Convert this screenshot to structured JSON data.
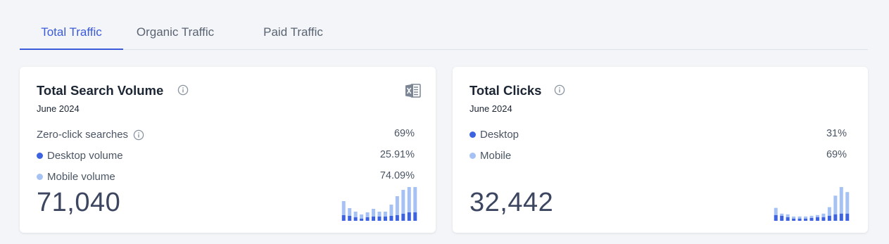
{
  "tabs": [
    {
      "label": "Total Traffic",
      "active": true
    },
    {
      "label": "Organic Traffic",
      "active": false
    },
    {
      "label": "Paid Traffic",
      "active": false
    }
  ],
  "colors": {
    "accent": "#3b5bdb",
    "desktop": "#3d63e0",
    "mobile": "#a6c2f5"
  },
  "search_volume": {
    "title": "Total Search Volume",
    "period": "June 2024",
    "icon": "excel-export-icon",
    "rows": [
      {
        "label": "Zero-click searches",
        "value": "69%",
        "dot": null,
        "info": true
      },
      {
        "label": "Desktop volume",
        "value": "25.91%",
        "dot": "desktop",
        "info": false
      },
      {
        "label": "Mobile volume",
        "value": "74.09%",
        "dot": "mobile",
        "info": false
      }
    ],
    "total": "71,040"
  },
  "clicks": {
    "title": "Total Clicks",
    "period": "June 2024",
    "rows": [
      {
        "label": "Desktop",
        "value": "31%",
        "dot": "desktop"
      },
      {
        "label": "Mobile",
        "value": "69%",
        "dot": "mobile"
      }
    ],
    "total": "32,442"
  },
  "sparklines": {
    "search_volume": {
      "series": [
        {
          "name": "desktop",
          "values": [
            8,
            7,
            5,
            3,
            5,
            6,
            6,
            6,
            7,
            8,
            10,
            12,
            12
          ]
        },
        {
          "name": "mobile",
          "values": [
            20,
            11,
            8,
            6,
            7,
            11,
            7,
            7,
            16,
            27,
            34,
            36,
            36
          ]
        }
      ]
    },
    "clicks": {
      "series": [
        {
          "name": "desktop",
          "values": [
            8,
            7,
            5,
            3,
            3,
            3,
            4,
            5,
            5,
            7,
            9,
            10,
            10
          ]
        },
        {
          "name": "mobile",
          "values": [
            10,
            3,
            4,
            3,
            3,
            3,
            3,
            3,
            5,
            12,
            26,
            37,
            30
          ]
        }
      ]
    }
  }
}
